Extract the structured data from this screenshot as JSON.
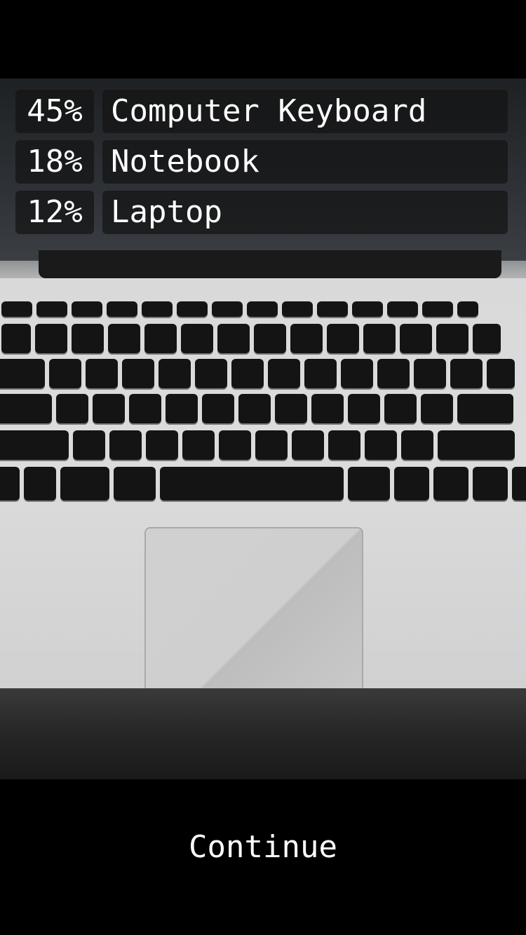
{
  "predictions": [
    {
      "percent": "45%",
      "label": "Computer Keyboard",
      "confidence": 0.45
    },
    {
      "percent": "18%",
      "label": "Notebook",
      "confidence": 0.18
    },
    {
      "percent": "12%",
      "label": "Laptop",
      "confidence": 0.12
    }
  ],
  "actions": {
    "continue_label": "Continue"
  },
  "colors": {
    "background": "#000000",
    "text": "#ffffff",
    "overlay": "#141414"
  }
}
